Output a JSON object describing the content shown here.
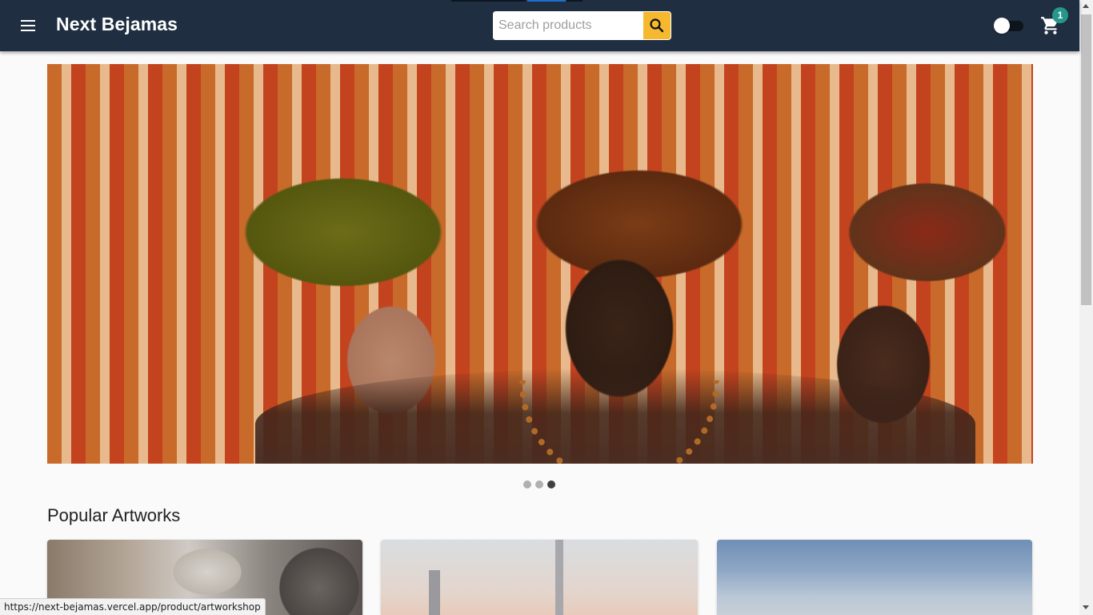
{
  "header": {
    "brand": "Next Bejamas",
    "search_placeholder": "Search products",
    "cart_count": "1",
    "colors": {
      "appbar": "#1f2e40",
      "search_button": "#f5b82e",
      "badge": "#26978a"
    }
  },
  "carousel": {
    "slides_count": 3,
    "active_slide": 3
  },
  "popular": {
    "title": "Popular Artworks"
  },
  "status_bar": {
    "url": "https://next-bejamas.vercel.app/product/artworkshop"
  }
}
